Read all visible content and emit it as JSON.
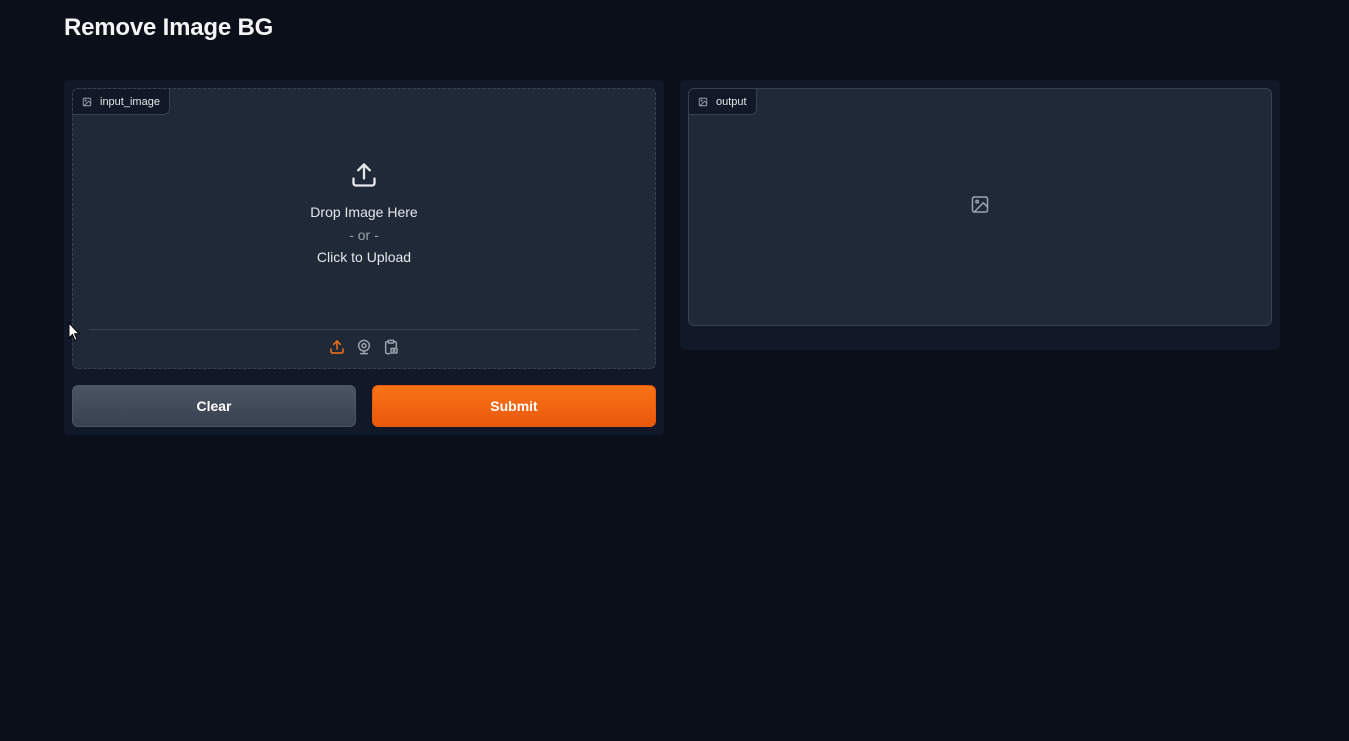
{
  "app": {
    "title": "Remove Image BG"
  },
  "input": {
    "label": "input_image",
    "drop_text": "Drop Image Here",
    "or_text": "- or -",
    "click_text": "Click to Upload",
    "sources": [
      "upload-icon",
      "webcam-icon",
      "clipboard-icon"
    ],
    "active_source": "upload"
  },
  "output": {
    "label": "output",
    "placeholder_icon": "image-icon"
  },
  "buttons": {
    "clear_label": "Clear",
    "submit_label": "Submit"
  },
  "colors": {
    "background": "#0b0f19",
    "panel": "#111827",
    "block": "#1f2937",
    "border": "#374151",
    "accent": "#f97316",
    "clear_button": "#4b5563"
  }
}
